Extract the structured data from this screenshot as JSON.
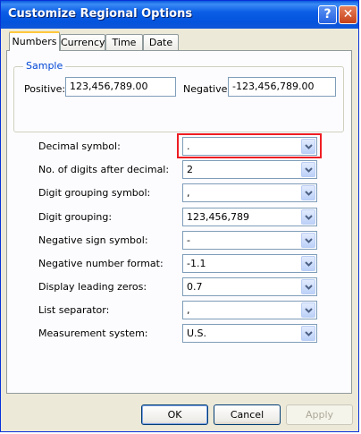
{
  "window": {
    "title": "Customize Regional Options",
    "help_label": "?",
    "close_label": "✕"
  },
  "tabs": [
    {
      "label": "Numbers"
    },
    {
      "label": "Currency"
    },
    {
      "label": "Time"
    },
    {
      "label": "Date"
    }
  ],
  "sample": {
    "legend": "Sample",
    "positive_label": "Positive:",
    "positive_value": "123,456,789.00",
    "negative_label": "Negative:",
    "negative_value": "-123,456,789.00"
  },
  "settings": [
    {
      "label": "Decimal symbol:",
      "value": "."
    },
    {
      "label": "No. of digits after decimal:",
      "value": "2"
    },
    {
      "label": "Digit grouping symbol:",
      "value": ","
    },
    {
      "label": "Digit grouping:",
      "value": "123,456,789"
    },
    {
      "label": "Negative sign symbol:",
      "value": "-"
    },
    {
      "label": "Negative number format:",
      "value": "-1.1"
    },
    {
      "label": "Display leading zeros:",
      "value": "0.7"
    },
    {
      "label": "List separator:",
      "value": ","
    },
    {
      "label": "Measurement system:",
      "value": "U.S."
    }
  ],
  "buttons": {
    "ok": "OK",
    "cancel": "Cancel",
    "apply": "Apply"
  },
  "icons": {
    "help": "help-icon",
    "close": "close-icon",
    "dropdown": "chevron-down-icon"
  },
  "colors": {
    "title_bar": "#0a5ae0",
    "focus_highlight": "#ee1d23",
    "group_legend": "#0046d5"
  }
}
